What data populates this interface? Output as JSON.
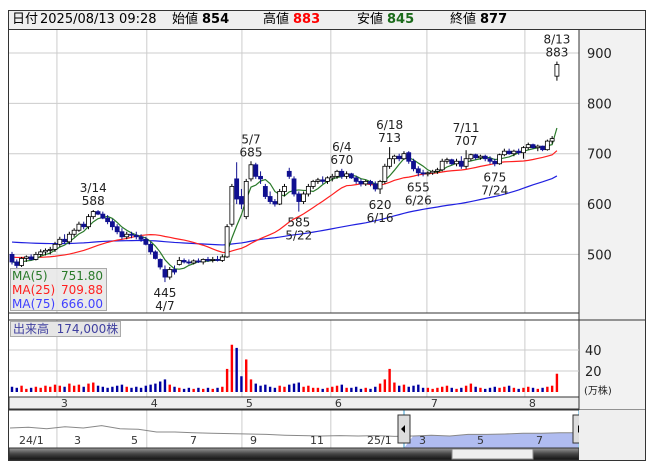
{
  "header": {
    "date_label": "日付",
    "datetime": "2025/08/13 09:28",
    "open_label": "始値",
    "open": "854",
    "high_label": "高値",
    "high": "883",
    "low_label": "安値",
    "low": "845",
    "close_label": "終値",
    "close": "877"
  },
  "legend": {
    "ma5_label": "MA(5)",
    "ma5": "751.80",
    "ma25_label": "MA(25)",
    "ma25": "709.88",
    "ma75_label": "MA(75)",
    "ma75": "666.00"
  },
  "volume": {
    "label": "出来高",
    "value": "174,000株",
    "unit": "(万株)"
  },
  "colors": {
    "up_border": "#000000",
    "down_fill": "#101090",
    "ma5": "#2a7a2a",
    "ma25": "#ff2020",
    "ma75": "#2020e0",
    "vol_up": "#ff0000",
    "vol_down": "#0000a0",
    "nav_fill": "#b0bcf0"
  },
  "chart_data": {
    "type": "candlestick",
    "price_axis": {
      "ticks": [
        "500",
        "600",
        "700",
        "800",
        "900"
      ],
      "ylim": [
        450,
        930
      ]
    },
    "volume_axis": {
      "ticks": [
        "20",
        "40"
      ],
      "unit": "万株"
    },
    "month_labels": [
      {
        "label": "3",
        "index": 9.4
      },
      {
        "label": "4",
        "index": 28.2
      },
      {
        "label": "5",
        "index": 48.1
      },
      {
        "label": "6",
        "index": 66.7
      },
      {
        "label": "7",
        "index": 86.8
      },
      {
        "label": "8",
        "index": 107.3
      }
    ],
    "ma_seed": {
      "ma25": 495,
      "ma75": 525
    },
    "ohlc": [
      [
        500,
        505,
        480,
        485
      ],
      [
        485,
        490,
        470,
        478
      ],
      [
        478,
        495,
        475,
        492
      ],
      [
        492,
        498,
        485,
        495
      ],
      [
        495,
        500,
        488,
        490
      ],
      [
        490,
        505,
        488,
        500
      ],
      [
        500,
        510,
        495,
        505
      ],
      [
        505,
        512,
        498,
        508
      ],
      [
        508,
        515,
        500,
        510
      ],
      [
        510,
        525,
        505,
        520
      ],
      [
        520,
        535,
        515,
        530
      ],
      [
        530,
        540,
        522,
        525
      ],
      [
        525,
        545,
        520,
        540
      ],
      [
        540,
        552,
        535,
        548
      ],
      [
        548,
        565,
        545,
        560
      ],
      [
        560,
        565,
        550,
        555
      ],
      [
        555,
        580,
        550,
        575
      ],
      [
        575,
        588,
        570,
        585
      ],
      [
        585,
        588,
        578,
        580
      ],
      [
        580,
        585,
        570,
        572
      ],
      [
        572,
        578,
        560,
        565
      ],
      [
        565,
        570,
        548,
        555
      ],
      [
        555,
        560,
        540,
        545
      ],
      [
        545,
        552,
        530,
        535
      ],
      [
        535,
        545,
        530,
        540
      ],
      [
        540,
        545,
        532,
        538
      ],
      [
        538,
        545,
        530,
        535
      ],
      [
        535,
        540,
        525,
        530
      ],
      [
        530,
        535,
        518,
        520
      ],
      [
        520,
        525,
        500,
        505
      ],
      [
        505,
        508,
        490,
        492
      ],
      [
        490,
        492,
        470,
        475
      ],
      [
        470,
        478,
        445,
        455
      ],
      [
        455,
        475,
        450,
        470
      ],
      [
        470,
        478,
        460,
        465
      ],
      [
        480,
        495,
        478,
        488
      ],
      [
        488,
        492,
        482,
        485
      ],
      [
        485,
        490,
        480,
        483
      ],
      [
        483,
        490,
        480,
        487
      ],
      [
        487,
        492,
        483,
        485
      ],
      [
        485,
        492,
        480,
        490
      ],
      [
        490,
        495,
        485,
        488
      ],
      [
        488,
        495,
        484,
        490
      ],
      [
        490,
        497,
        486,
        488
      ],
      [
        488,
        500,
        485,
        495
      ],
      [
        495,
        560,
        493,
        555
      ],
      [
        560,
        640,
        555,
        635
      ],
      [
        650,
        683,
        600,
        610
      ],
      [
        615,
        630,
        590,
        600
      ],
      [
        575,
        650,
        570,
        645
      ],
      [
        650,
        685,
        645,
        678
      ],
      [
        678,
        682,
        650,
        655
      ],
      [
        655,
        665,
        640,
        650
      ],
      [
        635,
        640,
        610,
        615
      ],
      [
        615,
        625,
        600,
        605
      ],
      [
        605,
        610,
        595,
        600
      ],
      [
        600,
        630,
        598,
        625
      ],
      [
        625,
        640,
        615,
        635
      ],
      [
        665,
        672,
        650,
        655
      ],
      [
        650,
        655,
        615,
        620
      ],
      [
        620,
        625,
        585,
        605
      ],
      [
        605,
        625,
        600,
        620
      ],
      [
        620,
        640,
        615,
        635
      ],
      [
        635,
        648,
        630,
        645
      ],
      [
        645,
        652,
        640,
        648
      ],
      [
        648,
        655,
        640,
        645
      ],
      [
        645,
        655,
        640,
        652
      ],
      [
        652,
        660,
        645,
        655
      ],
      [
        655,
        668,
        650,
        665
      ],
      [
        665,
        670,
        650,
        655
      ],
      [
        655,
        665,
        650,
        660
      ],
      [
        660,
        662,
        650,
        652
      ],
      [
        652,
        656,
        640,
        645
      ],
      [
        645,
        650,
        635,
        640
      ],
      [
        640,
        648,
        636,
        645
      ],
      [
        645,
        648,
        635,
        640
      ],
      [
        640,
        645,
        625,
        630
      ],
      [
        630,
        648,
        620,
        645
      ],
      [
        645,
        680,
        640,
        675
      ],
      [
        675,
        713,
        670,
        690
      ],
      [
        690,
        698,
        680,
        695
      ],
      [
        695,
        700,
        685,
        690
      ],
      [
        690,
        705,
        688,
        700
      ],
      [
        702,
        705,
        680,
        685
      ],
      [
        685,
        690,
        665,
        670
      ],
      [
        670,
        675,
        655,
        662
      ],
      [
        662,
        668,
        655,
        660
      ],
      [
        660,
        665,
        655,
        662
      ],
      [
        662,
        668,
        658,
        665
      ],
      [
        665,
        672,
        660,
        668
      ],
      [
        668,
        690,
        665,
        685
      ],
      [
        685,
        692,
        680,
        688
      ],
      [
        688,
        690,
        678,
        680
      ],
      [
        680,
        690,
        675,
        685
      ],
      [
        685,
        695,
        670,
        675
      ],
      [
        675,
        707,
        670,
        690
      ],
      [
        690,
        700,
        685,
        698
      ],
      [
        698,
        700,
        688,
        692
      ],
      [
        692,
        698,
        688,
        695
      ],
      [
        695,
        698,
        685,
        690
      ],
      [
        690,
        695,
        680,
        685
      ],
      [
        685,
        690,
        675,
        680
      ],
      [
        680,
        700,
        678,
        698
      ],
      [
        698,
        710,
        695,
        705
      ],
      [
        705,
        710,
        698,
        700
      ],
      [
        700,
        708,
        695,
        705
      ],
      [
        705,
        710,
        698,
        702
      ],
      [
        702,
        715,
        690,
        712
      ],
      [
        712,
        722,
        708,
        718
      ],
      [
        718,
        720,
        710,
        712
      ],
      [
        712,
        718,
        705,
        715
      ],
      [
        715,
        716,
        705,
        708
      ],
      [
        708,
        728,
        706,
        725
      ],
      [
        725,
        735,
        720,
        730
      ],
      [
        854,
        883,
        845,
        877
      ]
    ],
    "volume": [
      5,
      4,
      6,
      3,
      4,
      5,
      4,
      6,
      5,
      7,
      6,
      5,
      8,
      6,
      7,
      5,
      8,
      9,
      6,
      5,
      4,
      5,
      6,
      7,
      5,
      4,
      5,
      4,
      6,
      7,
      8,
      10,
      12,
      7,
      5,
      4,
      3,
      4,
      3,
      4,
      3,
      4,
      3,
      4,
      5,
      22,
      45,
      42,
      15,
      31,
      12,
      8,
      6,
      7,
      5,
      4,
      6,
      5,
      7,
      8,
      9,
      5,
      6,
      4,
      4,
      3,
      4,
      5,
      6,
      7,
      4,
      4,
      5,
      3,
      4,
      3,
      5,
      8,
      12,
      22,
      9,
      6,
      7,
      5,
      6,
      7,
      4,
      4,
      3,
      4,
      5,
      6,
      4,
      3,
      4,
      6,
      8,
      5,
      4,
      3,
      4,
      5,
      4,
      5,
      6,
      4,
      3,
      4,
      5,
      4,
      3,
      4,
      5,
      6,
      17.4
    ],
    "annotations": [
      {
        "date": "3/14",
        "value": "588",
        "index": 17,
        "pos": "above"
      },
      {
        "date": "4/7",
        "value": "445",
        "index": 32,
        "pos": "below"
      },
      {
        "date": "5/7",
        "value": "685",
        "index": 50,
        "pos": "above"
      },
      {
        "date": "5/22",
        "value": "585",
        "index": 60,
        "pos": "below"
      },
      {
        "date": "6/4",
        "value": "670",
        "index": 69,
        "pos": "above"
      },
      {
        "date": "6/16",
        "value": "620",
        "index": 77,
        "pos": "below"
      },
      {
        "date": "6/18",
        "value": "713",
        "index": 79,
        "pos": "above"
      },
      {
        "date": "6/26",
        "value": "655",
        "index": 85,
        "pos": "below"
      },
      {
        "date": "7/11",
        "value": "707",
        "index": 95,
        "pos": "above"
      },
      {
        "date": "7/24",
        "value": "675",
        "index": 101,
        "pos": "below"
      },
      {
        "date": "8/13",
        "value": "883",
        "index": 114,
        "pos": "above"
      }
    ]
  },
  "navigator": {
    "labels": [
      "24/1",
      "3",
      "5",
      "7",
      "9",
      "11",
      "25/1",
      "3",
      "5",
      "7"
    ],
    "series": [
      60,
      62,
      58,
      63,
      60,
      66,
      58,
      57,
      50,
      50,
      48,
      47,
      46,
      45,
      44,
      42,
      41,
      40,
      41,
      40,
      41,
      39,
      40,
      42,
      40,
      44,
      44,
      45,
      47,
      47,
      48,
      48
    ]
  }
}
